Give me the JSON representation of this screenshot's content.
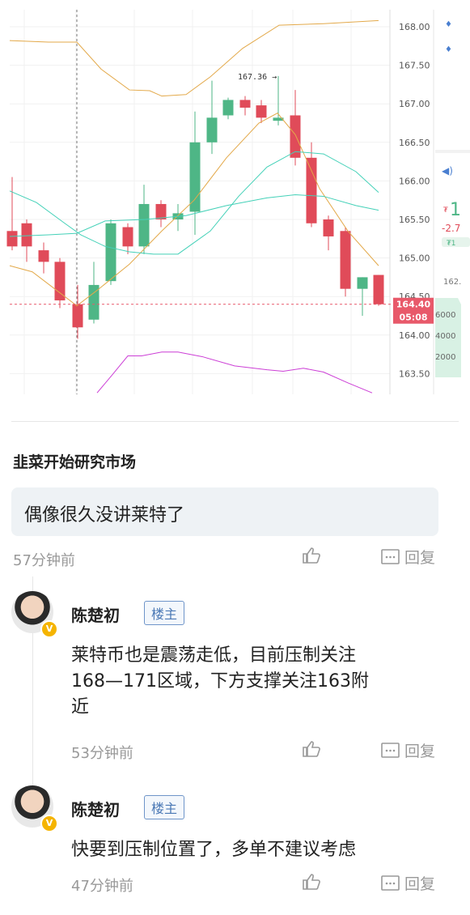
{
  "chart": {
    "y_ticks": [
      "168.00",
      "167.50",
      "167.00",
      "166.50",
      "166.00",
      "165.50",
      "165.00",
      "164.50",
      "164.00",
      "163.50"
    ],
    "max_label": "167.36",
    "current_price": "164.40",
    "countdown": "05:08",
    "right_panel": {
      "big_digit": "1",
      "change": "-2.7",
      "small_tag": "₮1",
      "price": "162.",
      "vol_ticks": [
        "6000",
        "4000",
        "2000"
      ]
    },
    "colors": {
      "up": "#4eb686",
      "down": "#e04b59",
      "ma_gold": "#e3a94a",
      "ma_teal": "#44d1b8",
      "band_pink": "#cc3fd6",
      "price_tag": "#e8596a"
    }
  },
  "post": {
    "title": "韭菜开始研究市场",
    "comment": "偶像很久没讲莱特了",
    "time": "57分钟前",
    "reply_label": "回复"
  },
  "replies": [
    {
      "name": "陈楚初",
      "badge": "楼主",
      "text_lines": [
        "莱特币也是震荡走低，目前压制关注",
        "168—171区域，下方支撑关注163附",
        "近"
      ],
      "time": "53分钟前",
      "reply_label": "回复"
    },
    {
      "name": "陈楚初",
      "badge": "楼主",
      "text_lines": [
        "快要到压制位置了，多单不建议考虑"
      ],
      "time": "47分钟前",
      "reply_label": "回复"
    }
  ]
}
